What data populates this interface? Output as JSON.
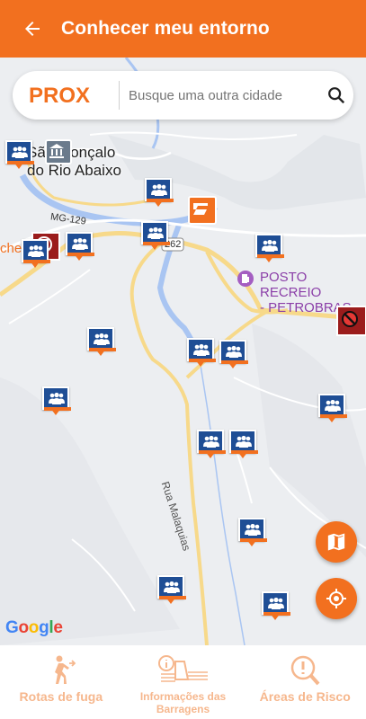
{
  "appbar": {
    "title": "Conhecer meu entorno"
  },
  "search": {
    "logo_text": "PROX",
    "placeholder": "Busque uma outra cidade"
  },
  "map": {
    "town_label_line1": "São Gonçalo",
    "town_label_line2": "do Rio Abaixo",
    "road_mg129": "MG-129",
    "road_262": "262",
    "poi_name_line1": "POSTO RECREIO",
    "poi_name_line2": "- PETROBRAS",
    "street_label": "Rua Malaquias",
    "partial_label_left": "che",
    "attribution": "Google"
  },
  "bottom_nav": {
    "items": [
      {
        "label": "Rotas de fuga",
        "icon": "walking-person-icon"
      },
      {
        "label": "Informações das Barragens",
        "icon": "dam-info-icon"
      },
      {
        "label": "Áreas de Risco",
        "icon": "magnifier-alert-icon"
      }
    ]
  },
  "colors": {
    "accent": "#f2701f",
    "pin_blue": "#1f4e95",
    "nav_label": "#f6b78d"
  }
}
